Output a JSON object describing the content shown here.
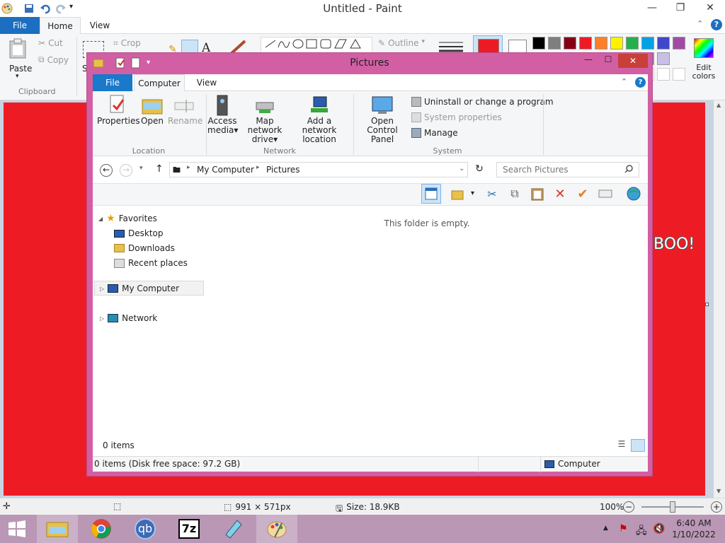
{
  "paint": {
    "title": "Untitled - Paint",
    "tabs": {
      "file": "File",
      "home": "Home",
      "view": "View"
    },
    "clipboard": {
      "paste": "Paste",
      "cut": "Cut",
      "copy": "Copy",
      "group": "Clipboard"
    },
    "image": {
      "crop": "Crop",
      "select_short": "S"
    },
    "shapes": {
      "outline": "Outline"
    },
    "edit_colors": "Edit colors",
    "colors": {
      "primary": "#ed1c24",
      "palette": [
        "#000000",
        "#7f7f7f",
        "#880015",
        "#ed1c24",
        "#ff7f27",
        "#fff200",
        "#22b14c",
        "#00a2e8",
        "#3f48cc",
        "#a349a4"
      ],
      "palette_row2": [
        "#c3c3c3",
        "#b97a57",
        "#ffaec9",
        "#ffc90e",
        "#efe4b0",
        "#b5e61d",
        "#99d9ea",
        "#7092be",
        "#c8bfe7"
      ]
    },
    "canvas_text": "BOO!",
    "status": {
      "dimensions": "991 × 571px",
      "size": "Size: 18.9KB",
      "zoom": "100%"
    }
  },
  "explorer": {
    "title": "Pictures",
    "tabs": {
      "file": "File",
      "computer": "Computer",
      "view": "View"
    },
    "ribbon": {
      "properties": "Properties",
      "open": "Open",
      "rename": "Rename",
      "location_group": "Location",
      "access_media_1": "Access",
      "access_media_2": "media",
      "map_drive_1": "Map network",
      "map_drive_2": "drive",
      "add_location_1": "Add a network",
      "add_location_2": "location",
      "network_group": "Network",
      "control_panel_1": "Open Control",
      "control_panel_2": "Panel",
      "uninstall": "Uninstall or change a program",
      "system_properties": "System properties",
      "manage": "Manage",
      "system_group": "System"
    },
    "address": {
      "root": "My Computer",
      "folder": "Pictures"
    },
    "search_placeholder": "Search Pictures",
    "nav": {
      "favorites": "Favorites",
      "desktop": "Desktop",
      "downloads": "Downloads",
      "recent": "Recent places",
      "my_computer": "My Computer",
      "network": "Network"
    },
    "empty_message": "This folder is empty.",
    "item_count": "0 items",
    "status_left": "0 items (Disk free space: 97.2 GB)",
    "status_right": "Computer"
  },
  "taskbar": {
    "time": "6:40 AM",
    "date": "1/10/2022",
    "apps": [
      "file-explorer",
      "chrome",
      "qbittorrent",
      "7-zip",
      "app",
      "paint"
    ],
    "qb_label": "qb",
    "sevenzip_label": "7z"
  }
}
